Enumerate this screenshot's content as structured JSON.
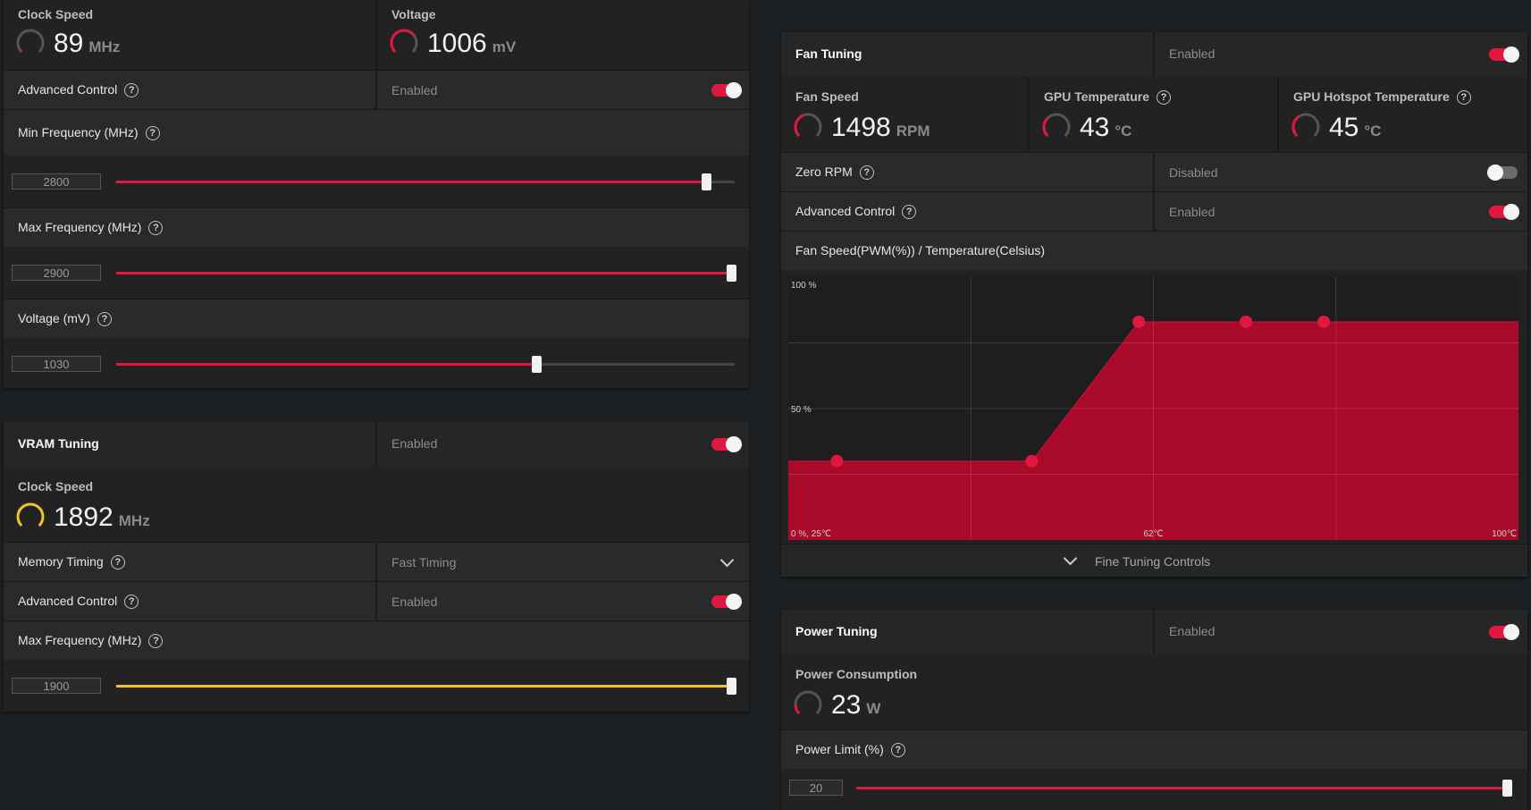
{
  "colors": {
    "accent": "#e0183f",
    "vram_accent": "#f2c12e"
  },
  "gpu": {
    "clock": {
      "title": "Clock Speed",
      "value": "89",
      "unit": "MHz"
    },
    "voltage": {
      "title": "Voltage",
      "value": "1006",
      "unit": "mV"
    },
    "advanced": {
      "label": "Advanced Control",
      "status": "Enabled"
    },
    "min_freq": {
      "label": "Min Frequency (MHz)",
      "value": "2800",
      "fraction": 0.955
    },
    "max_freq": {
      "label": "Max Frequency (MHz)",
      "value": "2900",
      "fraction": 1.0
    },
    "voltage_slider": {
      "label": "Voltage (mV)",
      "value": "1030",
      "fraction": 0.68
    }
  },
  "vram": {
    "title": "VRAM Tuning",
    "status": "Enabled",
    "clock": {
      "title": "Clock Speed",
      "value": "1892",
      "unit": "MHz"
    },
    "memory_timing": {
      "label": "Memory Timing",
      "value": "Fast Timing"
    },
    "advanced": {
      "label": "Advanced Control",
      "status": "Enabled"
    },
    "max_freq": {
      "label": "Max Frequency (MHz)",
      "value": "1900",
      "fraction": 1.0
    }
  },
  "fan": {
    "title": "Fan Tuning",
    "status": "Enabled",
    "speed": {
      "title": "Fan Speed",
      "value": "1498",
      "unit": "RPM"
    },
    "gpu_temp": {
      "title": "GPU Temperature",
      "value": "43",
      "unit": "°C"
    },
    "hotspot": {
      "title": "GPU Hotspot Temperature",
      "value": "45",
      "unit": "°C"
    },
    "zero_rpm": {
      "label": "Zero RPM",
      "status": "Disabled"
    },
    "advanced": {
      "label": "Advanced Control",
      "status": "Enabled"
    },
    "curve_title": "Fan Speed(PWM(%)) / Temperature(Celsius)",
    "fine_tuning": "Fine Tuning Controls"
  },
  "power": {
    "title": "Power Tuning",
    "status": "Enabled",
    "consumption": {
      "title": "Power Consumption",
      "value": "23",
      "unit": "W"
    },
    "limit": {
      "label": "Power Limit (%)",
      "value": "20",
      "fraction": 1.0
    }
  },
  "chart_data": {
    "type": "area",
    "title": "Fan Speed(PWM(%)) / Temperature(Celsius)",
    "xlabel": "",
    "ylabel": "",
    "x_tick_labels": [
      "0 %, 25℃",
      "62℃",
      "100℃"
    ],
    "y_tick_labels": [
      "100 %",
      "50 %"
    ],
    "xlim": [
      25,
      100
    ],
    "ylim": [
      0,
      100
    ],
    "grid": true,
    "series": [
      {
        "x": [
          25,
          30,
          50,
          61,
          72,
          80,
          100
        ],
        "y": [
          30,
          30,
          30,
          83,
          83,
          83,
          83
        ]
      }
    ],
    "control_points": {
      "x": [
        30,
        50,
        61,
        72,
        80
      ],
      "y": [
        30,
        30,
        83,
        83,
        83
      ]
    }
  }
}
